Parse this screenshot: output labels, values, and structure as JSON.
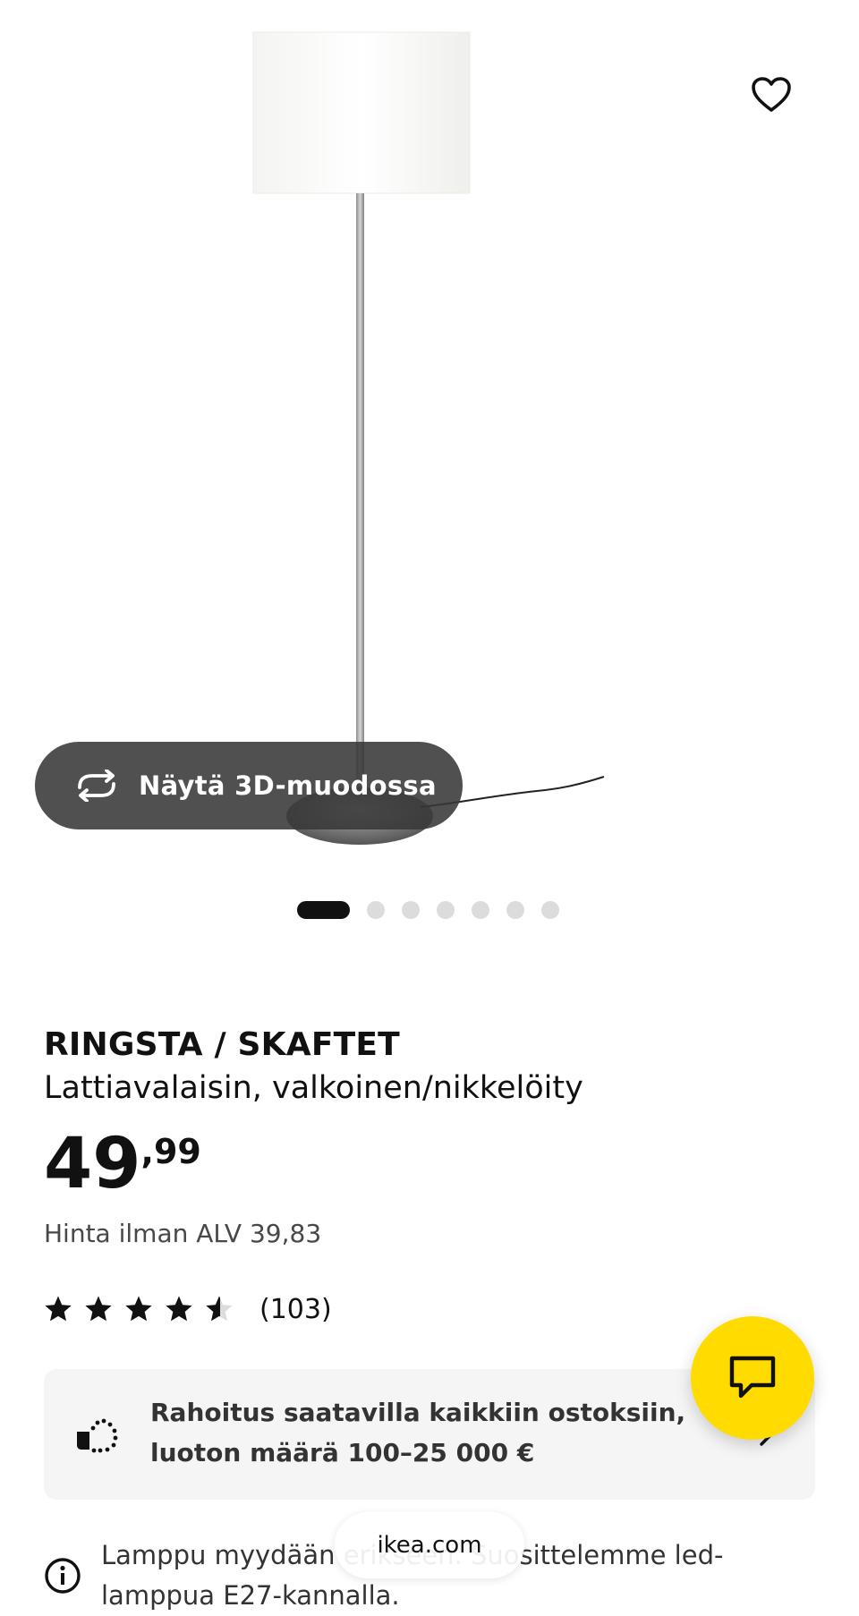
{
  "product": {
    "title": "RINGSTA / SKAFTET",
    "subtitle": "Lattiavalaisin, valkoinen/nikkelöity",
    "price_integer": "49",
    "price_decimal": ",99",
    "vat_text": "Hinta ilman ALV 39,83",
    "rating_value": 4.5,
    "rating_max": 5,
    "rating_count": "(103)"
  },
  "gallery": {
    "view_3d_label": "Näytä 3D-muodossa",
    "image_count": 7,
    "active_index": 0
  },
  "financing": {
    "text": "Rahoitus saatavilla kaikkiin ostoksiin, luoton määrä 100–25 000 €"
  },
  "info": {
    "text": "Lamppu myydään erikseen. Suosittelemme led-lamppua E27-kannalla."
  },
  "browser": {
    "url": "ikea.com"
  },
  "colors": {
    "chat_fab": "#ffdb00",
    "pill_bg": "#383838"
  },
  "icons": {
    "favorite": "heart-icon",
    "view3d": "rotate-3d-icon",
    "chat": "chat-bubble-icon",
    "financing": "financing-icon",
    "info": "info-icon",
    "chevron": "chevron-right-icon"
  }
}
